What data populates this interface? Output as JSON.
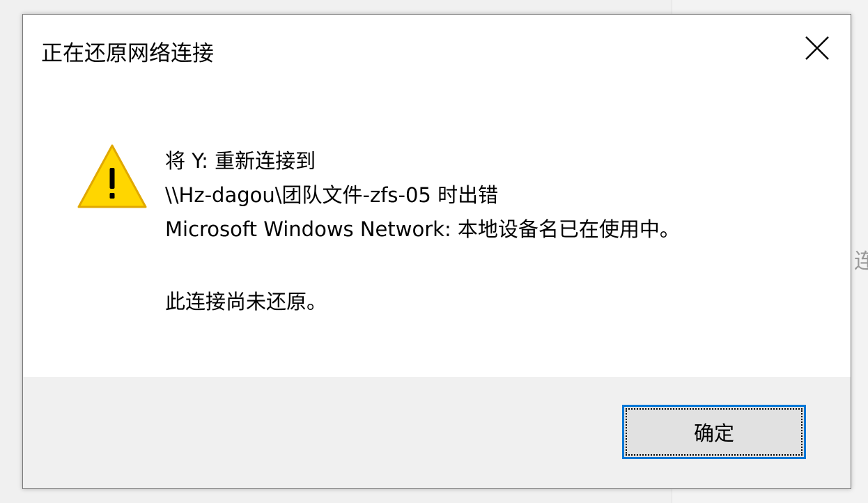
{
  "background": {
    "partial_text": "连"
  },
  "dialog": {
    "title": "正在还原网络连接",
    "close_icon": "close-icon",
    "warning_icon": "warning-triangle-icon",
    "message_lines": [
      "将 Y: 重新连接到",
      "\\\\Hz-dagou\\团队文件-zfs-05 时出错",
      "Microsoft Windows Network: 本地设备名已在使用中。"
    ],
    "status_line": "此连接尚未还原。",
    "ok_button_label": "确定"
  },
  "colors": {
    "accent": "#0078d7",
    "warning_fill": "#ffd600",
    "warning_stroke": "#e0a800",
    "footer_bg": "#f0f0f0"
  }
}
